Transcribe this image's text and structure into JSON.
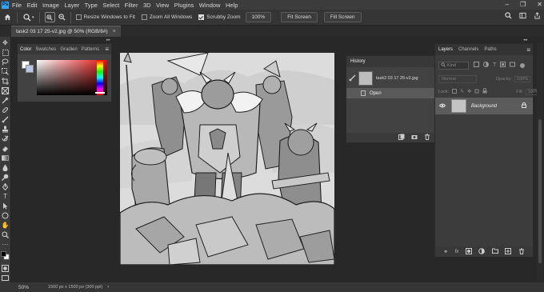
{
  "menu": [
    "File",
    "Edit",
    "Image",
    "Layer",
    "Type",
    "Select",
    "Filter",
    "3D",
    "View",
    "Plugins",
    "Window",
    "Help"
  ],
  "options": {
    "resize_windows": "Resize Windows to Fit",
    "zoom_all": "Zoom All Windows",
    "scrubby_zoom": "Scrubby Zoom",
    "zoom_value": "100%",
    "fit_screen": "Fit Screen",
    "fill_screen": "Fill Screen"
  },
  "tab": {
    "title": "task2 03 17 25-v2.jpg @ 50% (RGB/8#)",
    "close": "×"
  },
  "color_panel": {
    "tabs": [
      "Color",
      "Swatches",
      "Gradien",
      "Patterns"
    ]
  },
  "history_panel": {
    "title": "History",
    "snapshot_label": "task2 03 17 25-v2.jpg",
    "items": [
      "Open"
    ]
  },
  "layers_panel": {
    "tabs": [
      "Layers",
      "Channels",
      "Paths"
    ],
    "kind_placeholder": "Kind",
    "blend_mode": "Normal",
    "opacity_label": "Opacity:",
    "opacity_value": "100%",
    "lock_label": "Lock:",
    "fill_label": "Fill:",
    "fill_value": "100%",
    "layers": [
      {
        "name": "Background"
      }
    ]
  },
  "status": {
    "zoom": "50%",
    "doc_size": "1500 px x 1500 px (300 ppi)"
  },
  "colors": {
    "accent": "#31a8ff",
    "panel": "#424242",
    "bg": "#282828"
  }
}
